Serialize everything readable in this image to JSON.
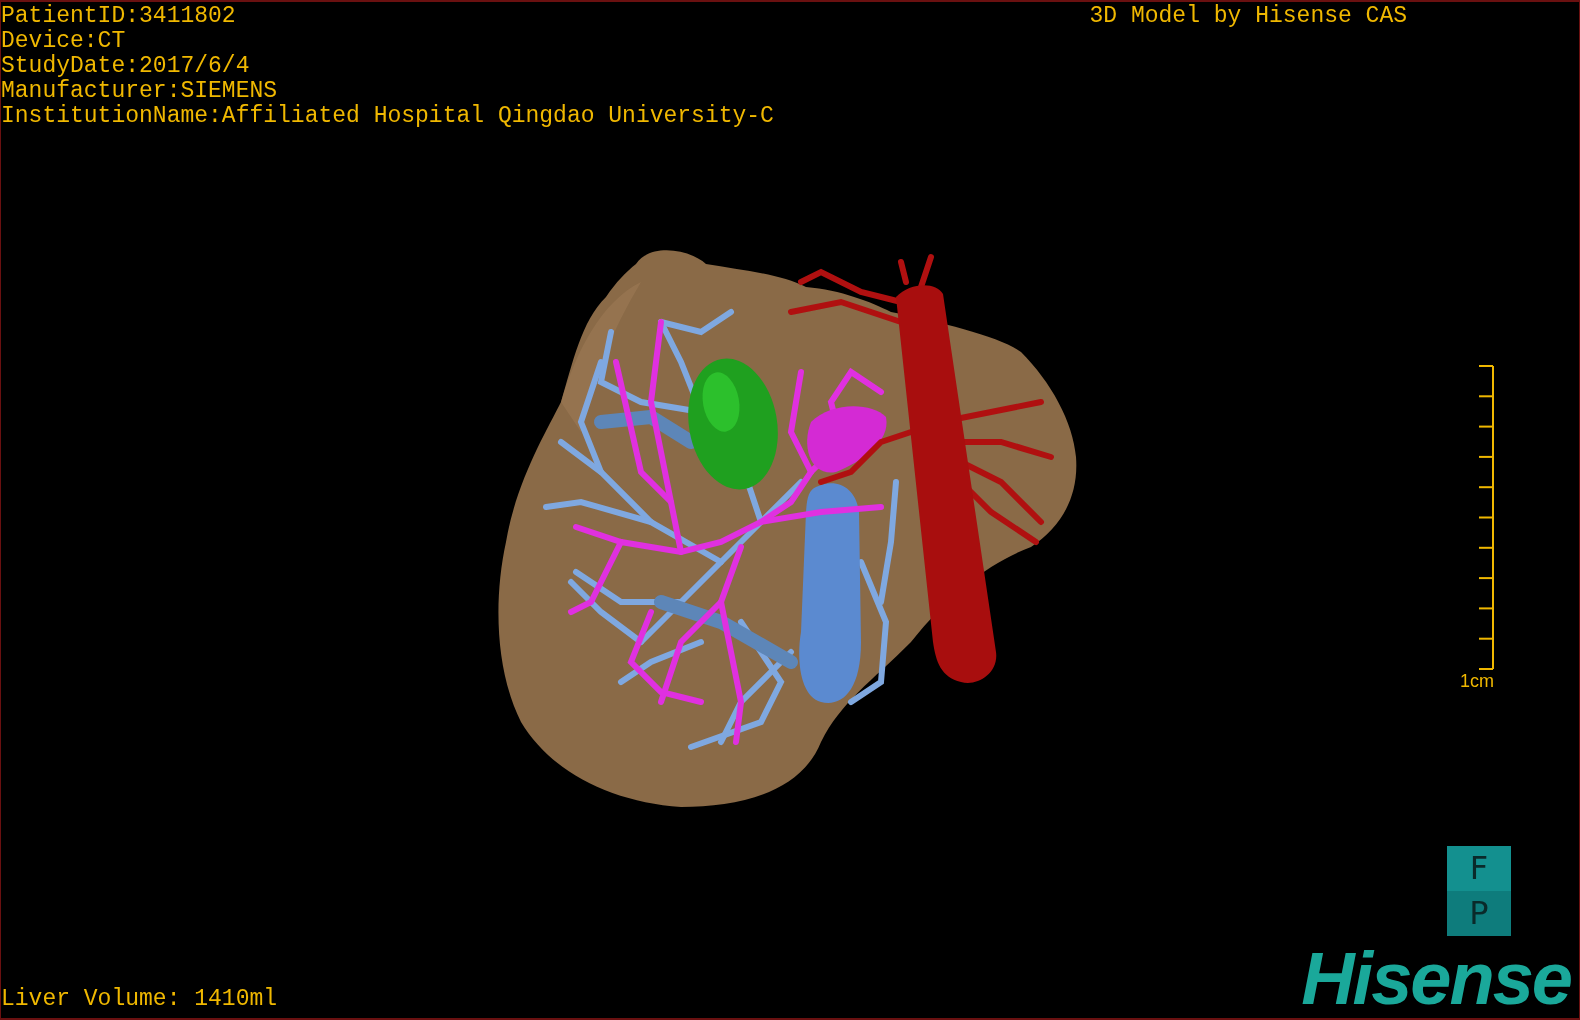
{
  "study_info": [
    "PatientID:3411802",
    "Device:CT",
    "StudyDate:2017/6/4",
    "Manufacturer:SIEMENS",
    "InstitutionName:Affiliated Hospital Qingdao University-C"
  ],
  "viewer_title": "3D Model by Hisense CAS",
  "scale_bar": {
    "label": "1cm"
  },
  "orientation_cube": [
    "F",
    "P"
  ],
  "liver_volume": "Liver Volume: 1410ml",
  "logo": "Hisense"
}
